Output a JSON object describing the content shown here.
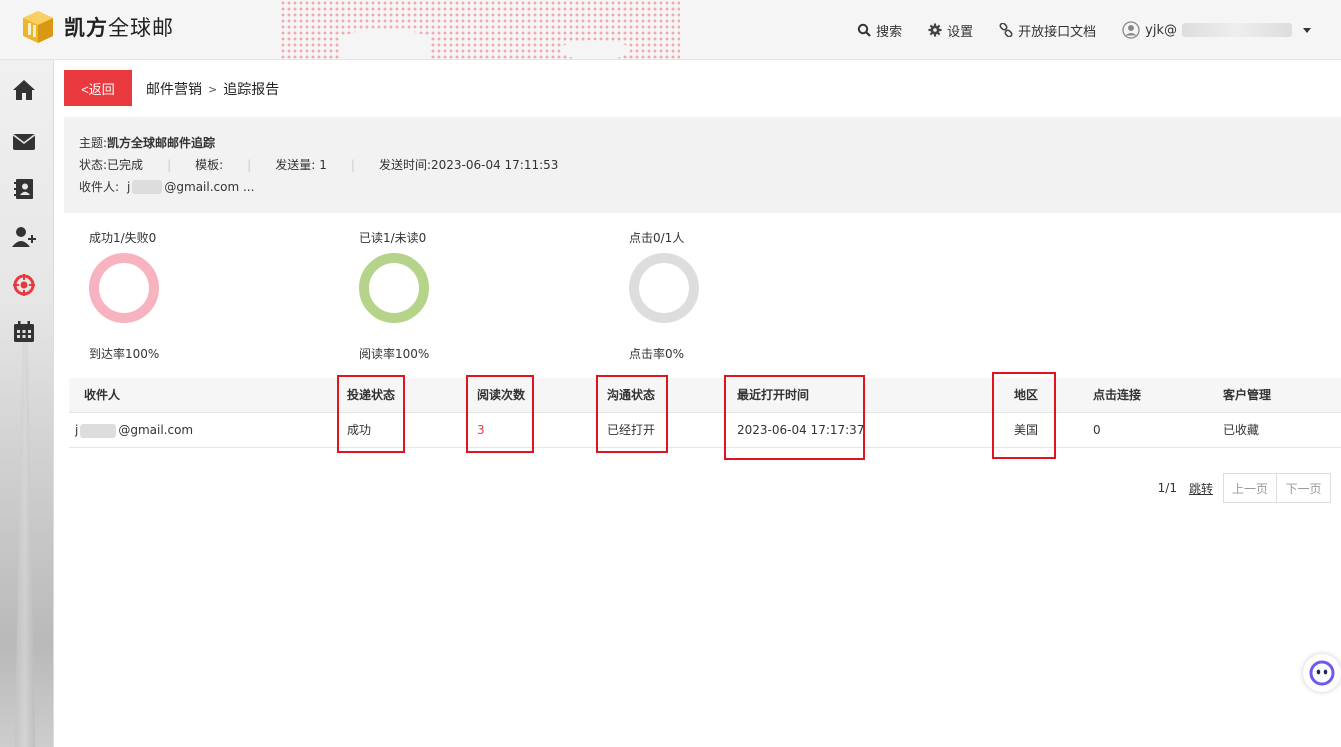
{
  "header": {
    "logo_bold": "凯方",
    "logo_thin": "全球邮",
    "nav": {
      "search": "搜索",
      "settings": "设置",
      "api_docs": "开放接口文档",
      "user_prefix": "yjk@"
    }
  },
  "breadcrumb": {
    "back_label": "<返回",
    "parent": "邮件营销",
    "separator": ">",
    "current": "追踪报告"
  },
  "info": {
    "subject_label": "主题:",
    "subject_value": "凯方全球邮邮件追踪",
    "status_label": "状态:",
    "status_value": "已完成",
    "template_label": "模板:",
    "template_value": "",
    "sent_count_label": "发送量:",
    "sent_count_value": "1",
    "sent_time_label": "发送时间:",
    "sent_time_value": "2023-06-04 17:11:53",
    "recipient_label": "收件人:",
    "recipient_prefix": "j",
    "recipient_suffix": "@gmail.com ..."
  },
  "stats": [
    {
      "top": "成功1/失败0",
      "bottom": "到达率100%",
      "color": "#f7b3bf",
      "rate": 1.0
    },
    {
      "top": "已读1/未读0",
      "bottom": "阅读率100%",
      "color": "#b5d48a",
      "rate": 1.0
    },
    {
      "top": "点击0/1人",
      "bottom": "点击率0%",
      "color": "#dddddd",
      "rate": 0.0
    }
  ],
  "table": {
    "headers": [
      "收件人",
      "投递状态",
      "阅读次数",
      "沟通状态",
      "最近打开时间",
      "地区",
      "点击连接",
      "客户管理"
    ],
    "row": {
      "recipient_prefix": "j",
      "recipient_suffix": "@gmail.com",
      "delivery": "成功",
      "reads": "3",
      "comm": "已经打开",
      "last_open": "2023-06-04 17:17:37",
      "region": "美国",
      "clicks": "0",
      "customer": "已收藏"
    }
  },
  "pager": {
    "page": "1/1",
    "jump": "跳转",
    "prev": "上一页",
    "next": "下一页"
  },
  "colors": {
    "accent": "#e8393f",
    "highlight": "#e1141e",
    "reads": "#e8393f"
  }
}
